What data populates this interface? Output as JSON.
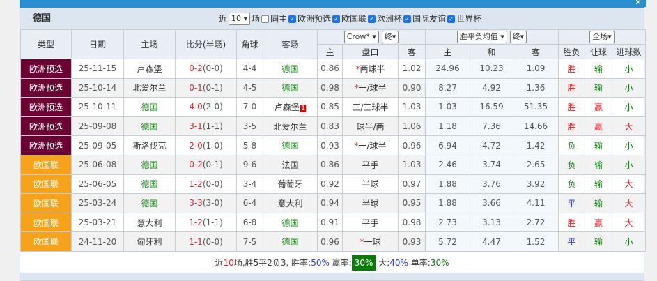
{
  "team": "德国",
  "filters": {
    "near": "近",
    "count": "10",
    "unit": "场",
    "same_home": "同主",
    "cups": [
      {
        "label": "欧洲预选",
        "checked": true
      },
      {
        "label": "欧国联",
        "checked": true
      },
      {
        "label": "欧洲杯",
        "checked": true
      },
      {
        "label": "国际友谊",
        "checked": true
      },
      {
        "label": "世界杯",
        "checked": true
      }
    ]
  },
  "headers": {
    "type": "类型",
    "date": "日期",
    "home": "主场",
    "score": "比分(半场)",
    "corner": "角球",
    "away": "客场",
    "company": "Crow*",
    "final1": "终",
    "odds_kind": "胜平负均值",
    "final2": "终",
    "scope": "全场",
    "ah_home": "主",
    "ah_line": "盘口",
    "ah_away": "客",
    "eu_home": "主",
    "eu_draw": "和",
    "eu_away": "客",
    "result": "胜负",
    "handicap": "让球",
    "goals": "进球数"
  },
  "colors": {
    "euro_qual": "#6b0033",
    "nations_league": "#f7a21b",
    "blue_bar": "#2a8fd0"
  },
  "rows": [
    {
      "type": "欧洲预选",
      "tc": "#6b0033",
      "date": "25-11-15",
      "home": "卢森堡",
      "hg": false,
      "ft": "0-2",
      "ht": "(0-0)",
      "corner": "4-4",
      "away": "德国",
      "ag": true,
      "badge": "",
      "h": "0.86",
      "star": "*",
      "line": "两球半",
      "a": "1.02",
      "w": "24.96",
      "d": "10.23",
      "l": "1.09",
      "res": "胜",
      "rc": "r",
      "hc": "输",
      "hcc": "dg",
      "gl": "小",
      "gc": "dg"
    },
    {
      "type": "欧洲预选",
      "tc": "#6b0033",
      "date": "25-10-14",
      "home": "北爱尔兰",
      "hg": false,
      "ft": "0-1",
      "ht": "(0-1)",
      "corner": "4-5",
      "away": "德国",
      "ag": true,
      "badge": "",
      "h": "0.98",
      "star": "*",
      "line": "一/球半",
      "a": "0.90",
      "w": "8.27",
      "d": "4.92",
      "l": "1.36",
      "res": "胜",
      "rc": "r",
      "hc": "输",
      "hcc": "dg",
      "gl": "小",
      "gc": "dg"
    },
    {
      "type": "欧洲预选",
      "tc": "#6b0033",
      "date": "25-10-11",
      "home": "德国",
      "hg": true,
      "ft": "4-0",
      "ht": "(2-0)",
      "corner": "7-0",
      "away": "卢森堡",
      "ag": false,
      "badge": "1",
      "h": "0.85",
      "star": "",
      "line": "三/三球半",
      "a": "1.03",
      "w": "1.03",
      "d": "16.59",
      "l": "51.35",
      "res": "胜",
      "rc": "r",
      "hc": "赢",
      "hcc": "r",
      "gl": "小",
      "gc": "dg"
    },
    {
      "type": "欧洲预选",
      "tc": "#6b0033",
      "date": "25-09-08",
      "home": "德国",
      "hg": true,
      "ft": "3-1",
      "ht": "(1-1)",
      "corner": "3-5",
      "away": "北爱尔兰",
      "ag": false,
      "badge": "",
      "h": "0.83",
      "star": "",
      "line": "球半/两",
      "a": "1.06",
      "w": "1.18",
      "d": "7.36",
      "l": "14.66",
      "res": "胜",
      "rc": "r",
      "hc": "赢",
      "hcc": "r",
      "gl": "大",
      "gc": "r"
    },
    {
      "type": "欧洲预选",
      "tc": "#6b0033",
      "date": "25-09-05",
      "home": "斯洛伐克",
      "hg": false,
      "ft": "2-0",
      "ht": "(1-0)",
      "corner": "5-8",
      "away": "德国",
      "ag": true,
      "badge": "",
      "h": "0.93",
      "star": "*",
      "line": "一/球半",
      "a": "0.96",
      "w": "6.94",
      "d": "4.72",
      "l": "1.42",
      "res": "负",
      "rc": "dg",
      "hc": "输",
      "hcc": "dg",
      "gl": "小",
      "gc": "dg"
    },
    {
      "type": "欧国联",
      "tc": "#f7a21b",
      "date": "25-06-08",
      "home": "德国",
      "hg": true,
      "ft": "0-2",
      "ht": "(0-1)",
      "corner": "9-6",
      "away": "法国",
      "ag": false,
      "badge": "",
      "h": "0.86",
      "star": "",
      "line": "平手",
      "a": "1.03",
      "w": "2.46",
      "d": "3.74",
      "l": "2.65",
      "res": "负",
      "rc": "dg",
      "hc": "输",
      "hcc": "dg",
      "gl": "小",
      "gc": "dg"
    },
    {
      "type": "欧国联",
      "tc": "#f7a21b",
      "date": "25-06-05",
      "home": "德国",
      "hg": true,
      "ft": "1-2",
      "ht": "(0-0)",
      "corner": "3-4",
      "away": "葡萄牙",
      "ag": false,
      "badge": "",
      "h": "0.92",
      "star": "",
      "line": "半球",
      "a": "0.97",
      "w": "1.88",
      "d": "3.76",
      "l": "3.92",
      "res": "负",
      "rc": "dg",
      "hc": "输",
      "hcc": "dg",
      "gl": "大",
      "gc": "r"
    },
    {
      "type": "欧国联",
      "tc": "#f7a21b",
      "date": "25-03-24",
      "home": "德国",
      "hg": true,
      "ft": "3-3",
      "ht": "(3-0)",
      "corner": "6-4",
      "away": "意大利",
      "ag": false,
      "badge": "",
      "h": "0.94",
      "star": "",
      "line": "半球",
      "a": "0.95",
      "w": "1.88",
      "d": "3.66",
      "l": "4.11",
      "res": "平",
      "rc": "b",
      "hc": "输",
      "hcc": "dg",
      "gl": "大",
      "gc": "r"
    },
    {
      "type": "欧国联",
      "tc": "#f7a21b",
      "date": "25-03-21",
      "home": "意大利",
      "hg": false,
      "ft": "1-2",
      "ht": "(1-1)",
      "corner": "6-8",
      "away": "德国",
      "ag": true,
      "badge": "",
      "h": "0.91",
      "star": "",
      "line": "平手",
      "a": "0.98",
      "w": "2.73",
      "d": "3.13",
      "l": "2.72",
      "res": "胜",
      "rc": "r",
      "hc": "赢",
      "hcc": "r",
      "gl": "大",
      "gc": "r"
    },
    {
      "type": "欧国联",
      "tc": "#f7a21b",
      "date": "24-11-20",
      "home": "匈牙利",
      "hg": false,
      "ft": "1-1",
      "ht": "(0-0)",
      "corner": "7-5",
      "away": "德国",
      "ag": true,
      "badge": "",
      "h": "0.96",
      "star": "*",
      "line": "一球",
      "a": "0.93",
      "w": "5.72",
      "d": "4.47",
      "l": "1.52",
      "res": "平",
      "rc": "b",
      "hc": "输",
      "hcc": "dg",
      "gl": "小",
      "gc": "dg"
    }
  ],
  "summary": {
    "p1": "近",
    "n": "10",
    "p2": "场,胜5平2负3, 胜率:",
    "win": "50%",
    "p3": " 赢率:",
    "cover": "30%",
    "p4": " 大:",
    "over": "40%",
    "p5": " 单率:",
    "odd": "30%"
  }
}
